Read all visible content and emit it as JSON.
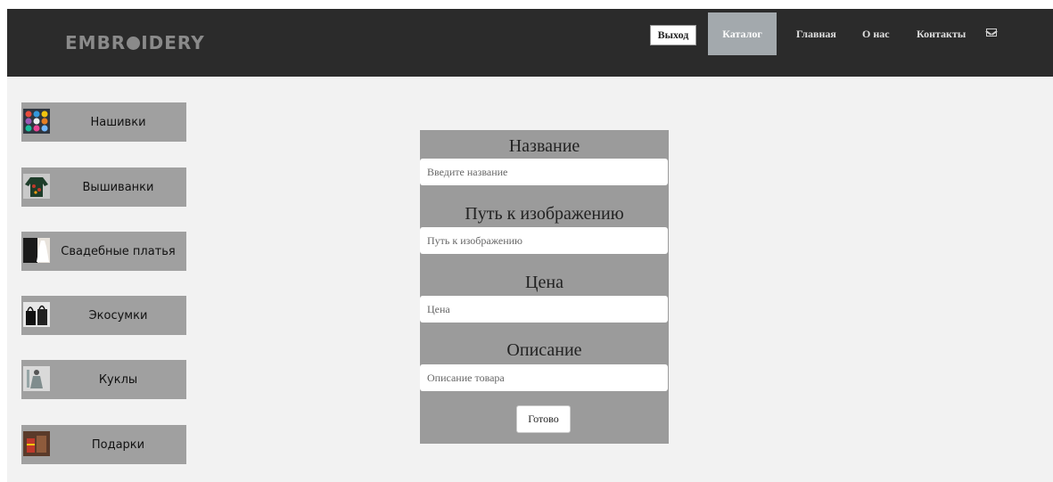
{
  "header": {
    "logo_left": "EMBR",
    "logo_right": "IDERY",
    "exit_label": "Выход",
    "nav": [
      {
        "label": "Каталог",
        "active": true
      },
      {
        "label": "Главная"
      },
      {
        "label": "О нас"
      },
      {
        "label": "Контакты"
      }
    ],
    "mail_icon": "envelope-icon"
  },
  "sidebar": {
    "items": [
      {
        "label": "Нашивки",
        "thumb": "patches-thumbnail"
      },
      {
        "label": "Вышиванки",
        "thumb": "embroidered-shirt-thumbnail"
      },
      {
        "label": "Свадебные платья",
        "thumb": "wedding-dress-thumbnail"
      },
      {
        "label": "Экосумки",
        "thumb": "eco-bag-thumbnail"
      },
      {
        "label": "Куклы",
        "thumb": "doll-thumbnail"
      },
      {
        "label": "Подарки",
        "thumb": "gift-thumbnail"
      }
    ]
  },
  "form": {
    "fields": [
      {
        "label": "Название",
        "placeholder": "Введите название"
      },
      {
        "label": "Путь к изображению",
        "placeholder": "Путь к изображению"
      },
      {
        "label": "Цена",
        "placeholder": "Цена"
      },
      {
        "label": "Описание",
        "placeholder": "Описание товара"
      }
    ],
    "submit_label": "Готово"
  },
  "colors": {
    "header_bg": "#2b2b2b",
    "page_bg": "#f2f2f2",
    "active_nav": "#a3a9ad",
    "panel": "#9b9b9b"
  }
}
